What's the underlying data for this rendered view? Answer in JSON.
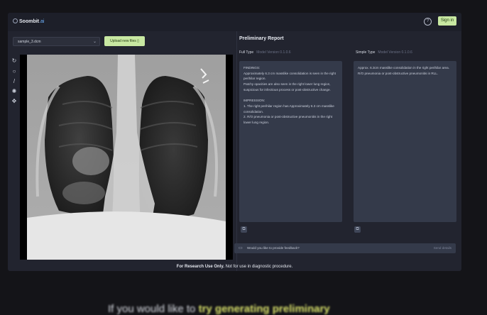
{
  "header": {
    "logo_text": "Soombit",
    "logo_suffix": ".ai",
    "help_glyph": "?",
    "signin_label": "Sign in"
  },
  "toolbar": {
    "file_select_value": "sample_3.dcm",
    "upload_label": "Upload new files",
    "tools": [
      {
        "icon": "reset-icon",
        "glyph": "↻"
      },
      {
        "icon": "zoom-icon",
        "glyph": "○"
      },
      {
        "icon": "pen-icon",
        "glyph": "/"
      },
      {
        "icon": "contrast-icon",
        "glyph": "✺"
      },
      {
        "icon": "move-icon",
        "glyph": "✥"
      }
    ]
  },
  "report": {
    "title": "Preliminary Report",
    "full_type": {
      "label": "Full Type",
      "version": "Model Version 0.1.0.6",
      "text": "FINDINGS:\nApproximately 6.3 cm masslike consolidation is seen in the right perihilar region.\nPatchy opacities are also seen in the right lower lung region, suspicious for infectious process or post-obstructive change.\n\nIMPRESSION:\n1. The right perihilar region has Approximately 6.3 cm masslike consolidation.\n2. R/O pneumonia or post-obstructive pneumonitis in the right lower lung region."
    },
    "simple_type": {
      "label": "Simple Type",
      "version": "Model Version 0.1.0.6",
      "text": "Approx. 6.3cm masslike consolidation in the right perihilar area.\nR/O pneumonia or post-obstructive pneumonitis in RLL."
    },
    "feedback_text": "Would you like to provide feedback?",
    "feedback_right": "Send details"
  },
  "disclaimer": {
    "bold": "For Research Use Only.",
    "rest": " Not for use in diagnostic procedure."
  },
  "caption": {
    "pre": "If you would like to ",
    "highlight": "try generating preliminary"
  },
  "colors": {
    "accent": "#c8e8a2",
    "panel": "#22242f",
    "textbox": "#343a4a"
  }
}
